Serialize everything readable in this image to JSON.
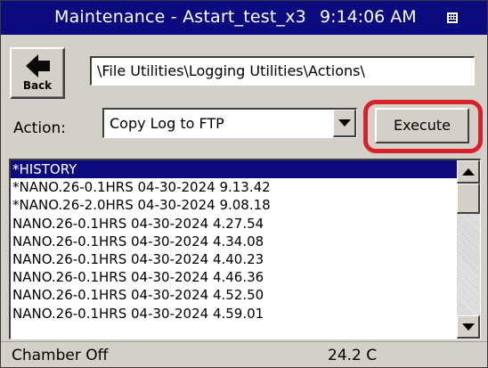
{
  "titlebar": {
    "title": "Maintenance - Astart_test_x3",
    "time": "9:14:06 AM",
    "icon": "keyboard-icon"
  },
  "toolbar": {
    "back_label": "Back",
    "back_icon": "back-arrow-icon",
    "path": "\\File Utilities\\Logging Utilities\\Actions\\"
  },
  "action": {
    "label": "Action:",
    "selected": "Copy Log to FTP",
    "execute_label": "Execute",
    "highlight_color": "#d8202a"
  },
  "file_list": {
    "items": [
      "*HISTORY",
      "*NANO.26-0.1HRS 04-30-2024 9.13.42",
      "*NANO.26-2.0HRS 04-30-2024 9.08.18",
      "NANO.26-0.1HRS 04-30-2024 4.27.54",
      "NANO.26-0.1HRS 04-30-2024 4.34.08",
      "NANO.26-0.1HRS 04-30-2024 4.40.23",
      "NANO.26-0.1HRS 04-30-2024 4.46.36",
      "NANO.26-0.1HRS 04-30-2024 4.52.50",
      "NANO.26-0.1HRS 04-30-2024 4.59.01"
    ],
    "selected_index": 0
  },
  "statusbar": {
    "status": "Chamber Off",
    "temperature": "24.2 C"
  },
  "colors": {
    "titlebar_bg": "#0b0b7f",
    "selection_bg": "#0b0b7f",
    "window_bg": "#d4d0c8"
  }
}
